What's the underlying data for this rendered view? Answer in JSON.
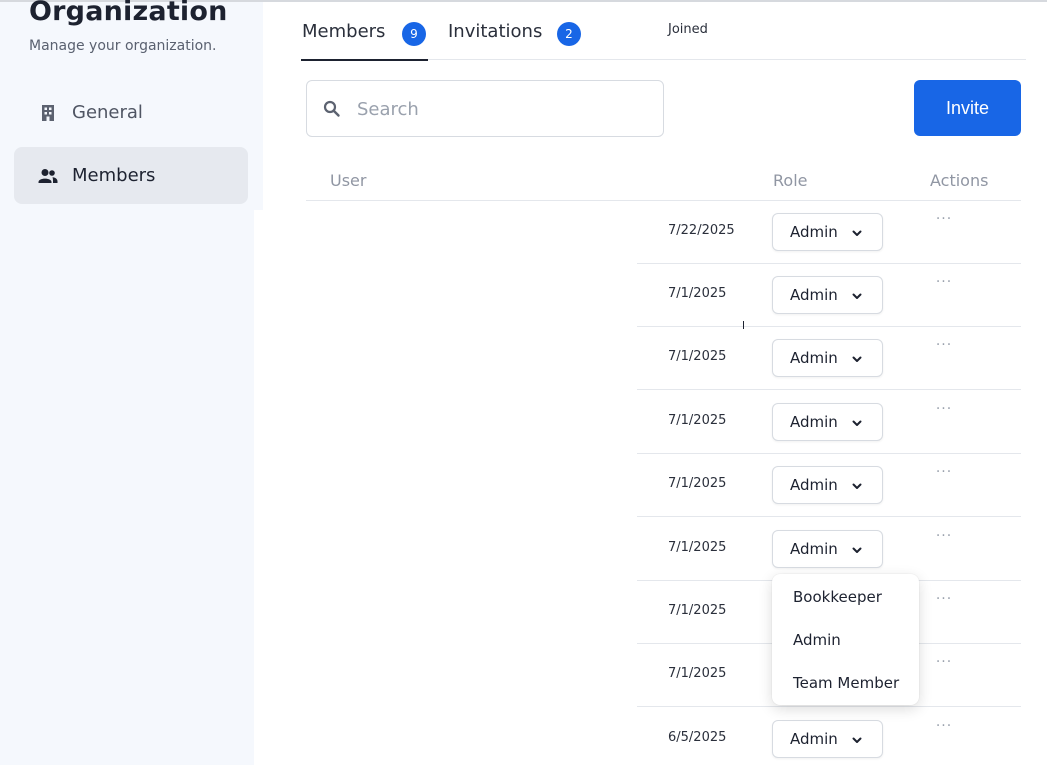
{
  "sidebar": {
    "title": "Organization",
    "subtitle": "Manage your organization.",
    "items": [
      {
        "label": "General",
        "icon": "building-icon",
        "active": false
      },
      {
        "label": "Members",
        "icon": "people-icon",
        "active": true
      }
    ]
  },
  "tabs": [
    {
      "label": "Members",
      "count": "9",
      "active": true
    },
    {
      "label": "Invitations",
      "count": "2",
      "active": false
    }
  ],
  "search": {
    "placeholder": "Search",
    "value": ""
  },
  "invite_button": "Invite",
  "table": {
    "headers": {
      "user": "User",
      "joined": "Joined",
      "role": "Role",
      "actions": "Actions"
    },
    "rows": [
      {
        "joined": "7/22/2025",
        "role": "Admin"
      },
      {
        "joined": "7/1/2025",
        "role": "Admin"
      },
      {
        "joined": "7/1/2025",
        "role": "Admin"
      },
      {
        "joined": "7/1/2025",
        "role": "Admin"
      },
      {
        "joined": "7/1/2025",
        "role": "Admin"
      },
      {
        "joined": "7/1/2025",
        "role": "Admin"
      },
      {
        "joined": "7/1/2025",
        "role": ""
      },
      {
        "joined": "7/1/2025",
        "role": ""
      },
      {
        "joined": "6/5/2025",
        "role": "Admin"
      }
    ],
    "actions_glyph": "···"
  },
  "role_dropdown": {
    "options": [
      "Bookkeeper",
      "Admin",
      "Team Member"
    ]
  },
  "colors": {
    "accent": "#1866e6",
    "sidebar_bg": "#f5f8fd",
    "active_nav_bg": "#e6e9ef"
  }
}
